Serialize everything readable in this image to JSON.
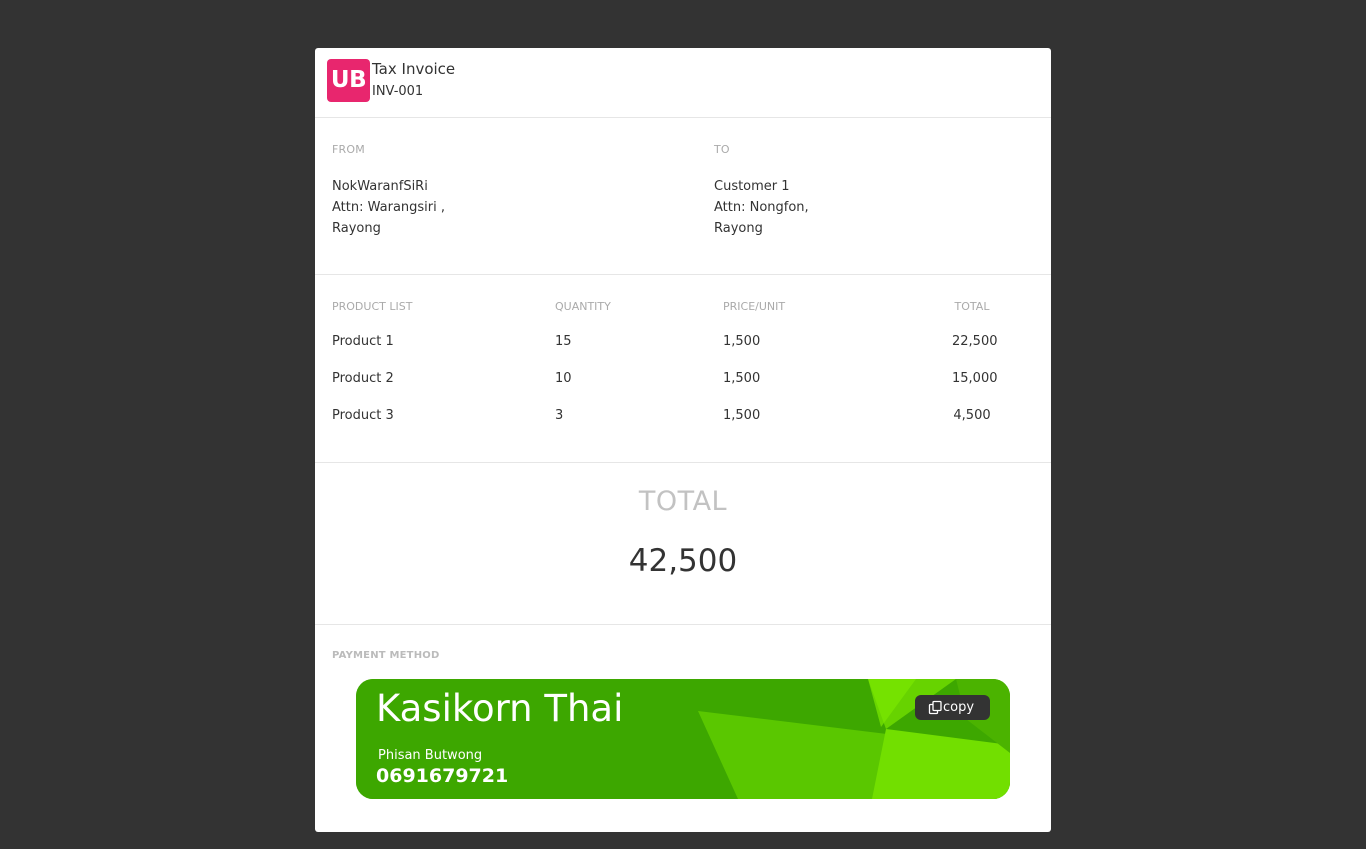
{
  "header": {
    "logo_text": "UB",
    "title": "Tax Invoice",
    "invoice_number": "INV-001"
  },
  "parties": {
    "from": {
      "label": "FROM",
      "lines": [
        "NokWaranfSiRi",
        "Attn: Warangsiri ,",
        "Rayong"
      ]
    },
    "to": {
      "label": "TO",
      "lines": [
        "Customer 1",
        "Attn: Nongfon,",
        "Rayong"
      ]
    }
  },
  "products": {
    "columns": [
      "PRODUCT LIST",
      "QUANTITY",
      "PRICE/UNIT",
      "TOTAL"
    ],
    "rows": [
      {
        "name": "Product 1",
        "quantity": "15",
        "price": "1,500",
        "total": "22,500"
      },
      {
        "name": "Product 2",
        "quantity": "10",
        "price": "1,500",
        "total": "15,000"
      },
      {
        "name": "Product 3",
        "quantity": "3",
        "price": "1,500",
        "total": "4,500"
      }
    ]
  },
  "summary": {
    "total_label": "TOTAL",
    "total_value": "42,500"
  },
  "payment": {
    "label": "PAYMENT METHOD",
    "bank_name": "Kasikorn Thai",
    "account_name": "Phisan Butwong",
    "account_number": "0691679721",
    "copy_label": "copy",
    "copy_icon": "copy-icon",
    "card_color": "#3da700",
    "card_accent": "#72df00"
  },
  "colors": {
    "page_background": "#333333",
    "logo": "#e8266e",
    "copy_button": "#333333"
  }
}
